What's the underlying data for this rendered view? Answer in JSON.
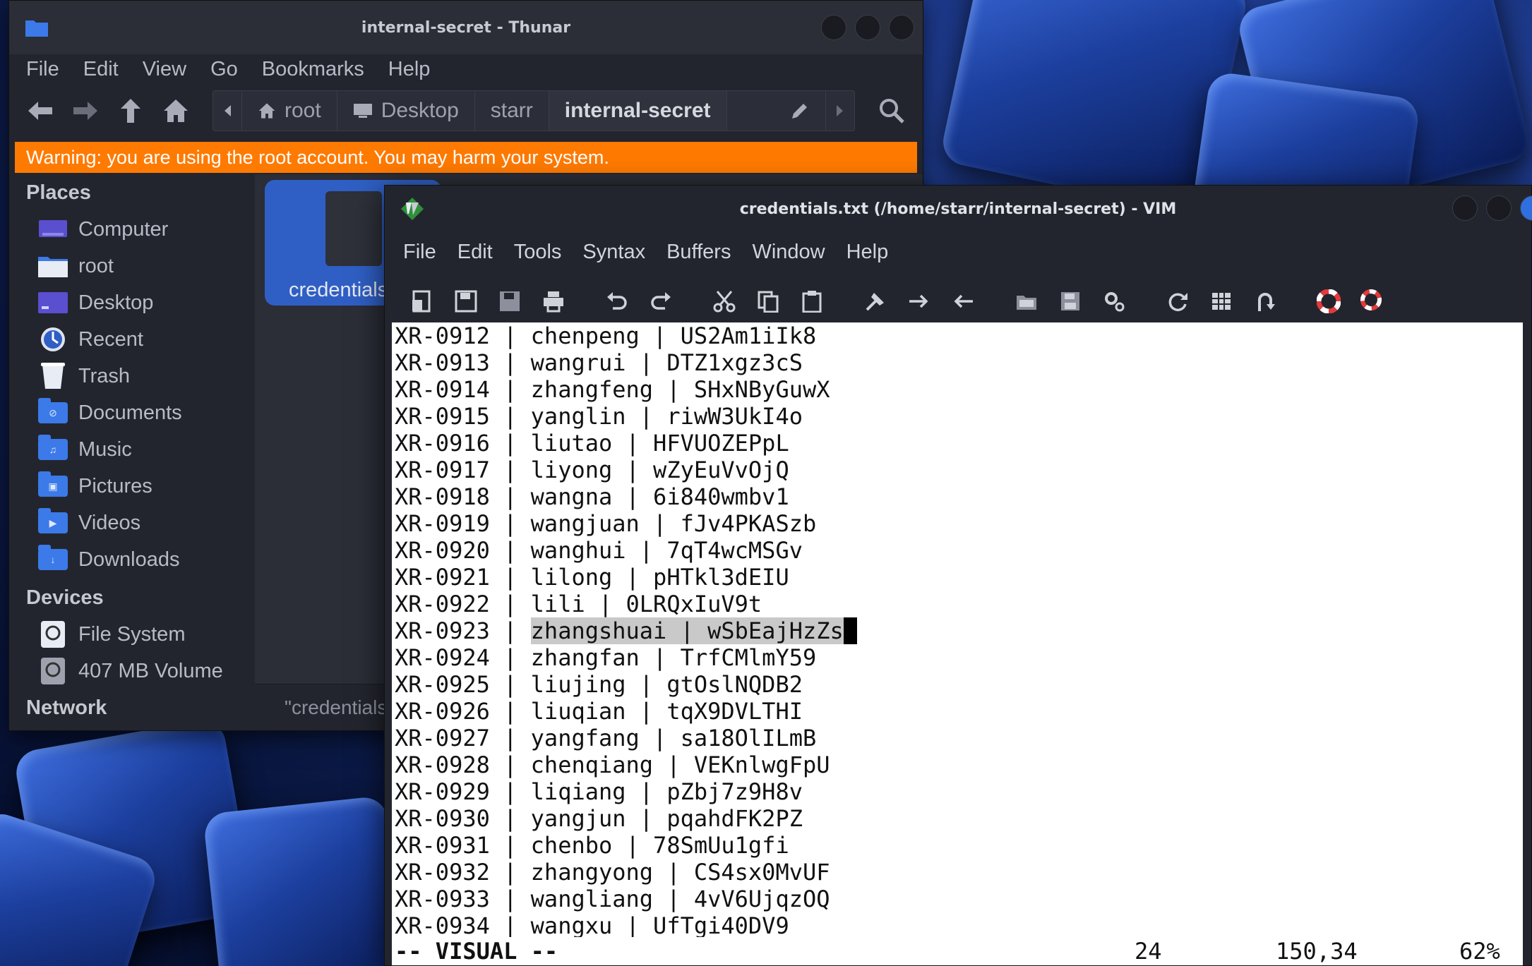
{
  "thunar": {
    "title": "internal-secret - Thunar",
    "menu": [
      "File",
      "Edit",
      "View",
      "Go",
      "Bookmarks",
      "Help"
    ],
    "path": [
      "root",
      "Desktop",
      "starr",
      "internal-secret"
    ],
    "warning": "Warning: you are using the root account. You may harm your system.",
    "places_heading": "Places",
    "places": [
      "Computer",
      "root",
      "Desktop",
      "Recent",
      "Trash",
      "Documents",
      "Music",
      "Pictures",
      "Videos",
      "Downloads"
    ],
    "devices_heading": "Devices",
    "devices": [
      "File System",
      "407 MB Volume"
    ],
    "network_heading": "Network",
    "file_label": "credentials",
    "status_text": "\"credentials"
  },
  "vim": {
    "title": "credentials.txt (/home/starr/internal-secret) - VIM",
    "menu": [
      "File",
      "Edit",
      "Tools",
      "Syntax",
      "Buffers",
      "Window",
      "Help"
    ],
    "lines": [
      {
        "id": "XR-0912",
        "user": "chenpeng",
        "pass": "US2Am1iIk8"
      },
      {
        "id": "XR-0913",
        "user": "wangrui",
        "pass": "DTZ1xgz3cS"
      },
      {
        "id": "XR-0914",
        "user": "zhangfeng",
        "pass": "SHxNByGuwX"
      },
      {
        "id": "XR-0915",
        "user": "yanglin",
        "pass": "riwW3UkI4o"
      },
      {
        "id": "XR-0916",
        "user": "liutao",
        "pass": "HFVUOZEPpL"
      },
      {
        "id": "XR-0917",
        "user": "liyong",
        "pass": "wZyEuVvOjQ"
      },
      {
        "id": "XR-0918",
        "user": "wangna",
        "pass": "6i840wmbv1"
      },
      {
        "id": "XR-0919",
        "user": "wangjuan",
        "pass": "fJv4PKASzb"
      },
      {
        "id": "XR-0920",
        "user": "wanghui",
        "pass": "7qT4wcMSGv"
      },
      {
        "id": "XR-0921",
        "user": "lilong",
        "pass": "pHTkl3dEIU"
      },
      {
        "id": "XR-0922",
        "user": "lili",
        "pass": "0LRQxIuV9t"
      },
      {
        "id": "XR-0923",
        "user": "zhangshuai",
        "pass": "wSbEajHzZs"
      },
      {
        "id": "XR-0924",
        "user": "zhangfan",
        "pass": "TrfCMlmY59"
      },
      {
        "id": "XR-0925",
        "user": "liujing",
        "pass": "gtOslNQDB2"
      },
      {
        "id": "XR-0926",
        "user": "liuqian",
        "pass": "tqX9DVLTHI"
      },
      {
        "id": "XR-0927",
        "user": "yangfang",
        "pass": "sa18OlILmB"
      },
      {
        "id": "XR-0928",
        "user": "chenqiang",
        "pass": "VEKnlwgFpU"
      },
      {
        "id": "XR-0929",
        "user": "liqiang",
        "pass": "pZbj7z9H8v"
      },
      {
        "id": "XR-0930",
        "user": "yangjun",
        "pass": "pqahdFK2PZ"
      },
      {
        "id": "XR-0931",
        "user": "chenbo",
        "pass": "78SmUu1gfi"
      },
      {
        "id": "XR-0932",
        "user": "zhangyong",
        "pass": "CS4sx0MvUF"
      },
      {
        "id": "XR-0933",
        "user": "wangliang",
        "pass": "4vV6UjqzOQ"
      },
      {
        "id": "XR-0934",
        "user": "wangxu",
        "pass": "UfTgi40DV9"
      }
    ],
    "selected_line_index": 11,
    "status": {
      "mode": "-- VISUAL --",
      "selection_count": "24",
      "position": "150,34",
      "percent": "62%"
    }
  },
  "colors": {
    "warning": "#ff7a00",
    "accent": "#3b7ae8",
    "selection": "#c9c9c9"
  }
}
